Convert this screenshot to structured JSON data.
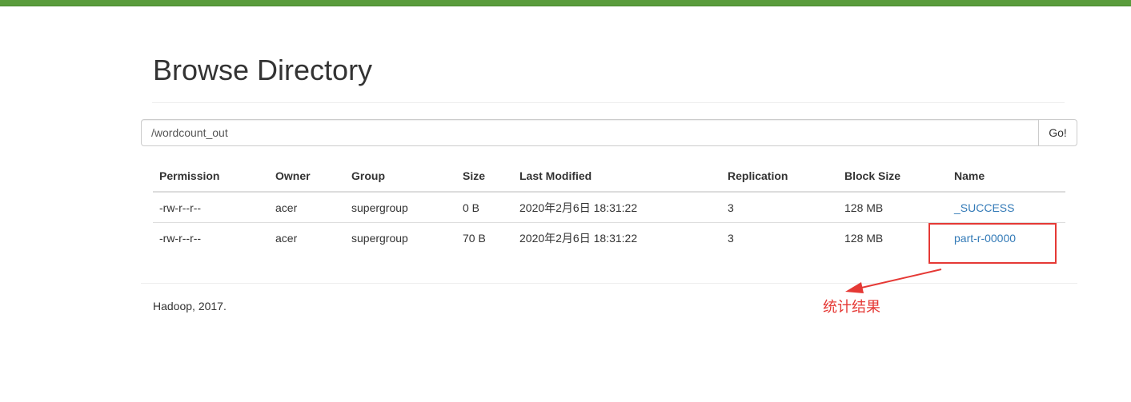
{
  "page": {
    "title": "Browse Directory",
    "accent_color": "#5a9c3c"
  },
  "path_form": {
    "value": "/wordcount_out",
    "go_label": "Go!"
  },
  "table": {
    "headers": [
      "Permission",
      "Owner",
      "Group",
      "Size",
      "Last Modified",
      "Replication",
      "Block Size",
      "Name"
    ],
    "rows": [
      {
        "permission": "-rw-r--r--",
        "owner": "acer",
        "group": "supergroup",
        "size": "0 B",
        "modified": "2020年2月6日 18:31:22",
        "replication": "3",
        "block_size": "128 MB",
        "name": "_SUCCESS"
      },
      {
        "permission": "-rw-r--r--",
        "owner": "acer",
        "group": "supergroup",
        "size": "70 B",
        "modified": "2020年2月6日 18:31:22",
        "replication": "3",
        "block_size": "128 MB",
        "name": "part-r-00000"
      }
    ]
  },
  "footer": {
    "text": "Hadoop, 2017."
  },
  "annotation": {
    "label": "统计结果",
    "color": "#e53935"
  }
}
